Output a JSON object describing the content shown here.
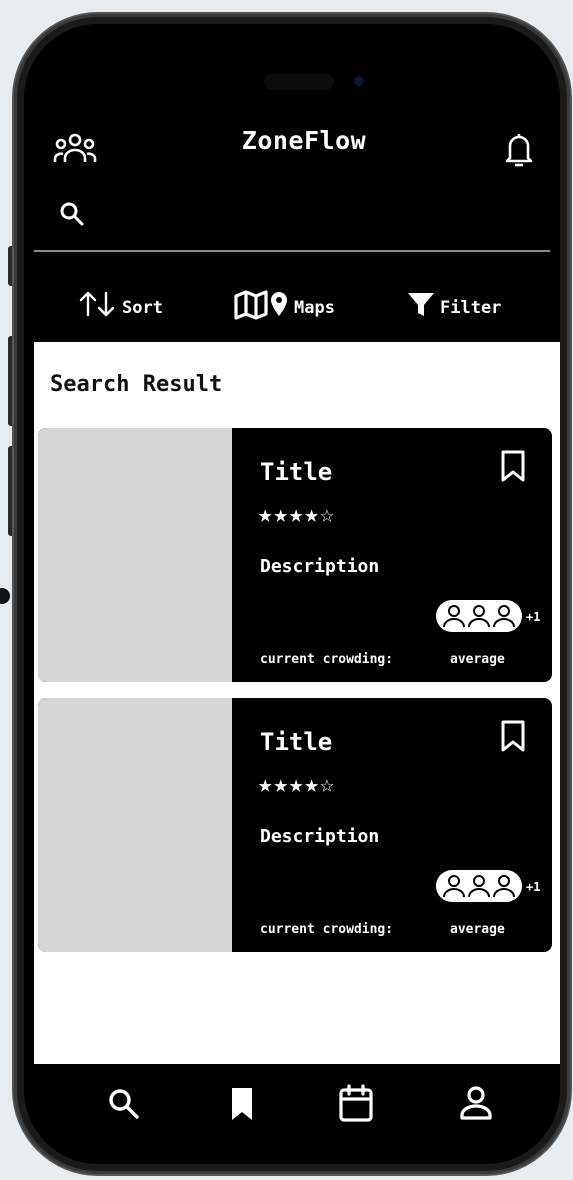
{
  "app": {
    "title": "ZoneFlow"
  },
  "header": {
    "people_icon": "people-group-icon",
    "bell_icon": "bell-icon",
    "search_icon": "search-icon"
  },
  "toolbar": {
    "sort_label": "Sort",
    "maps_label": "Maps",
    "filter_label": "Filter"
  },
  "main": {
    "heading": "Search Result",
    "cards": [
      {
        "title": "Title",
        "stars": "★★★★☆",
        "rating": 4,
        "description": "Description",
        "crowd_extra": "+1",
        "crowding_label": "current crowding:",
        "crowding_value": "average"
      },
      {
        "title": "Title",
        "stars": "★★★★☆",
        "rating": 4,
        "description": "Description",
        "crowd_extra": "+1",
        "crowding_label": "current crowding:",
        "crowding_value": "average"
      }
    ]
  },
  "bottom_nav": {
    "items": [
      "search-icon",
      "bookmark-icon",
      "calendar-icon",
      "profile-icon"
    ]
  },
  "colors": {
    "background": "#e6ecef",
    "phone": "#1a1a1a",
    "screen": "#000000",
    "content": "#ffffff",
    "thumbnail": "#d6d6d6"
  }
}
